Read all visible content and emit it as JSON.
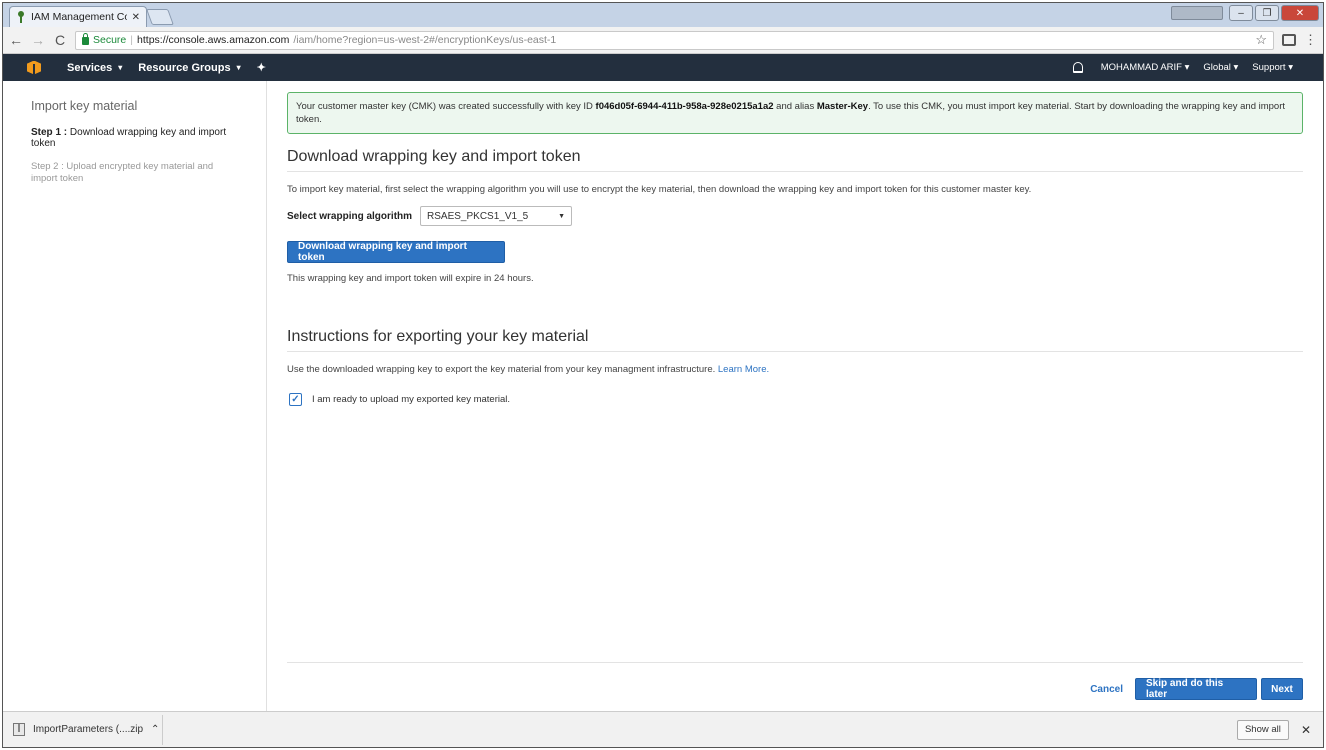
{
  "browser": {
    "tab_title": "IAM Management Conso",
    "tab_close": "✕",
    "secure_label": "Secure",
    "url_host": "https://console.aws.amazon.com",
    "url_path": "/iam/home?region=us-west-2#/encryptionKeys/us-east-1"
  },
  "nav": {
    "services": "Services",
    "resource_groups": "Resource Groups",
    "user": "MOHAMMAD ARIF",
    "region": "Global",
    "support": "Support"
  },
  "sidebar": {
    "title": "Import key material",
    "step1_prefix": "Step 1 :",
    "step1_text": "Download wrapping key and import token",
    "step2": "Step 2 : Upload encrypted key material and import token"
  },
  "alert": {
    "text_1": "Your customer master key (CMK) was created successfully with key ID ",
    "key_id": "f046d05f-6944-411b-958a-928e0215a1a2",
    "text_2": " and alias ",
    "alias": "Master-Key",
    "text_3": ". To use this CMK, you must import key material. Start by downloading the wrapping key and import token."
  },
  "download_section": {
    "heading": "Download wrapping key and import token",
    "description": "To import key material, first select the wrapping algorithm you will use to encrypt the key material, then download the wrapping key and import token for this customer master key.",
    "algorithm_label": "Select wrapping algorithm",
    "algorithm_value": "RSAES_PKCS1_V1_5",
    "button": "Download wrapping key and import token",
    "expiry": "This wrapping key and import token will expire in 24 hours."
  },
  "instructions_section": {
    "heading": "Instructions for exporting your key material",
    "description": "Use the downloaded wrapping key to export the key material from your key managment infrastructure.",
    "learn_more": "Learn More.",
    "checkbox_label": "I am ready to upload my exported key material.",
    "checked": true
  },
  "actions": {
    "cancel": "Cancel",
    "skip": "Skip and do this later",
    "next": "Next"
  },
  "download_bar": {
    "file": "ImportParameters (....zip",
    "show_all": "Show all"
  }
}
